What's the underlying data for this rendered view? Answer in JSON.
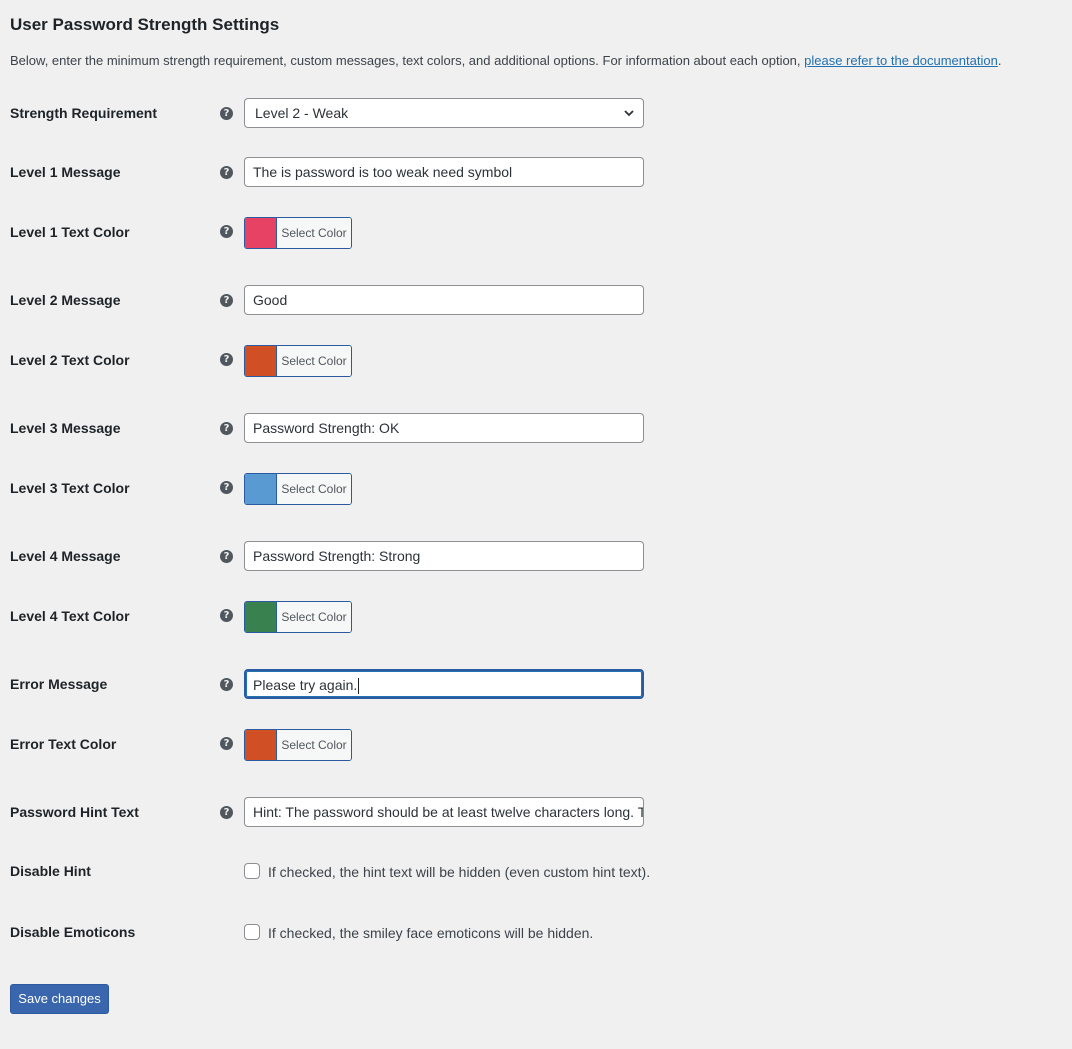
{
  "page": {
    "title": "User Password Strength Settings",
    "description_before_link": "Below, enter the minimum strength requirement, custom messages, text colors, and additional options. For information about each option, ",
    "description_link": "please refer to the documentation",
    "description_after_link": "."
  },
  "help_icon_glyph": "?",
  "fields": {
    "strength_requirement": {
      "label": "Strength Requirement",
      "selected": "Level 2 - Weak"
    },
    "level1_message": {
      "label": "Level 1 Message",
      "value": "The is password is too weak need symbol"
    },
    "level1_color": {
      "label": "Level 1 Text Color",
      "button_label": "Select Color",
      "color": "#e74263"
    },
    "level2_message": {
      "label": "Level 2 Message",
      "value": "Good"
    },
    "level2_color": {
      "label": "Level 2 Text Color",
      "button_label": "Select Color",
      "color": "#d14f25"
    },
    "level3_message": {
      "label": "Level 3 Message",
      "value": "Password Strength: OK"
    },
    "level3_color": {
      "label": "Level 3 Text Color",
      "button_label": "Select Color",
      "color": "#5a9ad3"
    },
    "level4_message": {
      "label": "Level 4 Message",
      "value": "Password Strength: Strong"
    },
    "level4_color": {
      "label": "Level 4 Text Color",
      "button_label": "Select Color",
      "color": "#3a8150"
    },
    "error_message": {
      "label": "Error Message",
      "value": "Please try again."
    },
    "error_color": {
      "label": "Error Text Color",
      "button_label": "Select Color",
      "color": "#d14f25"
    },
    "hint_text": {
      "label": "Password Hint Text",
      "value": "Hint: The password should be at least twelve characters long. T"
    },
    "disable_hint": {
      "label": "Disable Hint",
      "checkbox_label": "If checked, the hint text will be hidden (even custom hint text).",
      "checked": false
    },
    "disable_emoticons": {
      "label": "Disable Emoticons",
      "checkbox_label": "If checked, the smiley face emoticons will be hidden.",
      "checked": false
    }
  },
  "save_button_label": "Save changes",
  "colors": {
    "accent": "#2271b1",
    "save_button": "#3a66ad",
    "background": "#f0f0f1"
  }
}
